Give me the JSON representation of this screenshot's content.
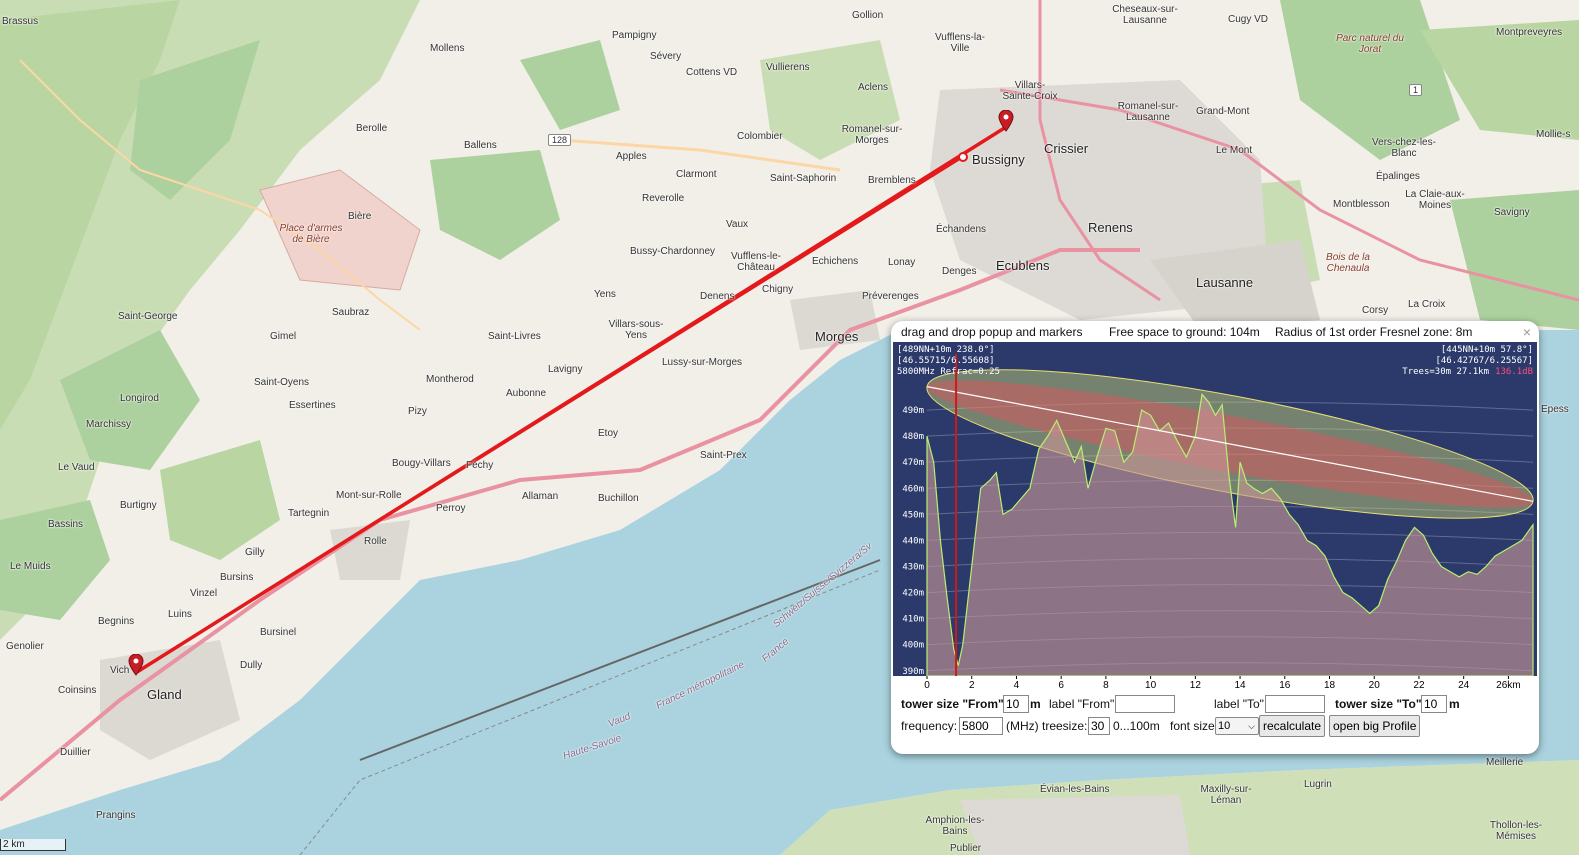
{
  "map": {
    "places": [
      {
        "id": "brassus",
        "label": "Brassus"
      },
      {
        "id": "mollens",
        "label": "Mollens"
      },
      {
        "id": "pampigny",
        "label": "Pampigny"
      },
      {
        "id": "gollion",
        "label": "Gollion"
      },
      {
        "id": "vufflens-la-ville",
        "label": "Vufflens-la-Ville"
      },
      {
        "id": "cheseaux",
        "label": "Cheseaux-sur-Lausanne"
      },
      {
        "id": "cugy",
        "label": "Cugy VD"
      },
      {
        "id": "montpreveyres",
        "label": "Montpreveyres"
      },
      {
        "id": "severy",
        "label": "Sévery"
      },
      {
        "id": "cottens",
        "label": "Cottens VD"
      },
      {
        "id": "vullierens",
        "label": "Vullierens"
      },
      {
        "id": "aclens",
        "label": "Aclens"
      },
      {
        "id": "villars-ste-croix",
        "label": "Villars-Sainte-Croix"
      },
      {
        "id": "romanel-lausanne",
        "label": "Romanel-sur-Lausanne"
      },
      {
        "id": "grand-mont",
        "label": "Grand-Mont"
      },
      {
        "id": "berolle",
        "label": "Berolle"
      },
      {
        "id": "ballens",
        "label": "Ballens"
      },
      {
        "id": "apples",
        "label": "Apples"
      },
      {
        "id": "colombier",
        "label": "Colombier"
      },
      {
        "id": "romanel-morges",
        "label": "Romanel-sur-Morges"
      },
      {
        "id": "bussigny",
        "label": "Bussigny"
      },
      {
        "id": "crissier",
        "label": "Crissier"
      },
      {
        "id": "le-mont",
        "label": "Le Mont"
      },
      {
        "id": "vers-chez-les-blanc",
        "label": "Vers-chez-les-Blanc"
      },
      {
        "id": "mollie",
        "label": "Mollie-s"
      },
      {
        "id": "clarmont",
        "label": "Clarmont"
      },
      {
        "id": "saint-saphorin",
        "label": "Saint-Saphorin"
      },
      {
        "id": "bremblens",
        "label": "Bremblens"
      },
      {
        "id": "epalinges",
        "label": "Épalinges"
      },
      {
        "id": "biere",
        "label": "Bière"
      },
      {
        "id": "reverolle",
        "label": "Reverolle"
      },
      {
        "id": "vaux",
        "label": "Vaux"
      },
      {
        "id": "echandens",
        "label": "Échandens"
      },
      {
        "id": "renens",
        "label": "Renens"
      },
      {
        "id": "montblesson",
        "label": "Montblesson"
      },
      {
        "id": "la-claie",
        "label": "La Claie-aux-Moines"
      },
      {
        "id": "savigny",
        "label": "Savigny"
      },
      {
        "id": "bussy-chardonney",
        "label": "Bussy-Chardonney"
      },
      {
        "id": "vufflens-le-chateau",
        "label": "Vufflens-le-Château"
      },
      {
        "id": "echichens",
        "label": "Echichens"
      },
      {
        "id": "lonay",
        "label": "Lonay"
      },
      {
        "id": "ecublens",
        "label": "Ecublens"
      },
      {
        "id": "denges",
        "label": "Denges"
      },
      {
        "id": "lausanne",
        "label": "Lausanne"
      },
      {
        "id": "yens",
        "label": "Yens"
      },
      {
        "id": "denens",
        "label": "Denens"
      },
      {
        "id": "chigny",
        "label": "Chigny"
      },
      {
        "id": "preverenges",
        "label": "Préverenges"
      },
      {
        "id": "la-croix",
        "label": "La Croix"
      },
      {
        "id": "corsy",
        "label": "Corsy"
      },
      {
        "id": "saint-george",
        "label": "Saint-George"
      },
      {
        "id": "saubraz",
        "label": "Saubraz"
      },
      {
        "id": "morges",
        "label": "Morges"
      },
      {
        "id": "gimel",
        "label": "Gimel"
      },
      {
        "id": "saint-livres",
        "label": "Saint-Livres"
      },
      {
        "id": "villars-sous-yens",
        "label": "Villars-sous-Yens"
      },
      {
        "id": "lussy",
        "label": "Lussy-sur-Morges"
      },
      {
        "id": "saint-oyens",
        "label": "Saint-Oyens"
      },
      {
        "id": "lavigny",
        "label": "Lavigny"
      },
      {
        "id": "longirod",
        "label": "Longirod"
      },
      {
        "id": "montherod",
        "label": "Montherod"
      },
      {
        "id": "aubonne",
        "label": "Aubonne"
      },
      {
        "id": "essertines",
        "label": "Essertines"
      },
      {
        "id": "pizy",
        "label": "Pizy"
      },
      {
        "id": "marchissy",
        "label": "Marchissy"
      },
      {
        "id": "etoy",
        "label": "Etoy"
      },
      {
        "id": "le-vaud",
        "label": "Le Vaud"
      },
      {
        "id": "bougy-villars",
        "label": "Bougy-Villars"
      },
      {
        "id": "fechy",
        "label": "Féchy"
      },
      {
        "id": "saint-prex",
        "label": "Saint-Prex"
      },
      {
        "id": "mont-sur-rolle",
        "label": "Mont-sur-Rolle"
      },
      {
        "id": "allaman",
        "label": "Allaman"
      },
      {
        "id": "buchillon",
        "label": "Buchillon"
      },
      {
        "id": "burtigny",
        "label": "Burtigny"
      },
      {
        "id": "tartegnin",
        "label": "Tartegnin"
      },
      {
        "id": "perroy",
        "label": "Perroy"
      },
      {
        "id": "bassins",
        "label": "Bassins"
      },
      {
        "id": "rolle",
        "label": "Rolle"
      },
      {
        "id": "gilly",
        "label": "Gilly"
      },
      {
        "id": "le-muids",
        "label": "Le Muids"
      },
      {
        "id": "bursins",
        "label": "Bursins"
      },
      {
        "id": "vinzel",
        "label": "Vinzel"
      },
      {
        "id": "luins",
        "label": "Luins"
      },
      {
        "id": "begnins",
        "label": "Begnins"
      },
      {
        "id": "bursinel",
        "label": "Bursinel"
      },
      {
        "id": "genolier",
        "label": "Genolier"
      },
      {
        "id": "vich",
        "label": "Vich"
      },
      {
        "id": "dully",
        "label": "Dully"
      },
      {
        "id": "coinsins",
        "label": "Coinsins"
      },
      {
        "id": "gland",
        "label": "Gland"
      },
      {
        "id": "duillier",
        "label": "Duillier"
      },
      {
        "id": "prangins",
        "label": "Prangins"
      },
      {
        "id": "meillerie",
        "label": "Meillerie"
      },
      {
        "id": "lugrin",
        "label": "Lugrin"
      },
      {
        "id": "evian",
        "label": "Évian-les-Bains"
      },
      {
        "id": "maxilly",
        "label": "Maxilly-sur-Léman"
      },
      {
        "id": "amphion",
        "label": "Amphion-les-Bains"
      },
      {
        "id": "thollon",
        "label": "Thollon-les-Mémises"
      },
      {
        "id": "publier",
        "label": "Publier"
      },
      {
        "id": "epesses",
        "label": "Epess"
      }
    ],
    "italic_labels": [
      {
        "id": "jorat",
        "label": "Parc naturel du Jorat"
      },
      {
        "id": "place-armes",
        "label": "Place d'armes de Bière"
      },
      {
        "id": "chenaula",
        "label": "Bois de la Chenaula"
      }
    ],
    "water_labels": [
      {
        "id": "vaud",
        "label": "Vaud"
      },
      {
        "id": "france-metro",
        "label": "France métropolitaine"
      },
      {
        "id": "haute-savoie",
        "label": "Haute-Savoie"
      },
      {
        "id": "france",
        "label": "France"
      },
      {
        "id": "schweiz",
        "label": "Schweiz/Suisse/Svizzera/Sv"
      }
    ],
    "road_badges": [
      {
        "id": "r128",
        "label": "128"
      },
      {
        "id": "r1",
        "label": "1"
      }
    ],
    "scale_label": "2 km",
    "colors": {
      "water": "#aad3df",
      "land": "#f2efe9",
      "forest": "#add19e",
      "link": "#e31a1c"
    }
  },
  "popup": {
    "header": {
      "drag_label": "drag and drop popup and markers",
      "free_space": "Free space to ground: 104m",
      "fresnel": "Radius of 1st order Fresnel zone: 8m",
      "close": "×"
    },
    "profile": {
      "info_left": [
        "[489NN+10m 238.0°]",
        "[46.55715/6.55608]",
        "5800MHz Refrac=0.25"
      ],
      "info_right": [
        "[445NN+10m 57.8°]",
        "[46.42767/6.25567]",
        "Trees=30m 27.1km"
      ],
      "loss": "136.1dB",
      "y_ticks": [
        "490m",
        "480m",
        "470m",
        "460m",
        "450m",
        "440m",
        "430m",
        "420m",
        "410m",
        "400m",
        "390m"
      ],
      "x_ticks": [
        "0",
        "2",
        "4",
        "6",
        "8",
        "10",
        "12",
        "14",
        "16",
        "18",
        "20",
        "22",
        "24",
        "26km"
      ]
    },
    "form": {
      "tower_from_label": "tower size \"From\"",
      "tower_from_value": "10",
      "unit_m": "m",
      "label_from": "label \"From\"",
      "label_from_value": "",
      "label_to": "label \"To\"",
      "label_to_value": "",
      "tower_to_label": "tower size \"To\"",
      "tower_to_value": "10",
      "frequency_label": "frequency:",
      "frequency_value": "5800",
      "mhz": "(MHz)",
      "treesize_label": "treesize:",
      "treesize_value": "30",
      "treesize_range": "0...100m",
      "fontsize_label": "font size",
      "fontsize_value": "10",
      "recalculate": "recalculate",
      "open_big": "open big Profile"
    }
  },
  "chart_data": {
    "type": "area",
    "title": "",
    "xlabel": "",
    "ylabel": "",
    "xlim": [
      0,
      27.1
    ],
    "ylim": [
      388,
      500
    ],
    "x_ticks": [
      0,
      2,
      4,
      6,
      8,
      10,
      12,
      14,
      16,
      18,
      20,
      22,
      24,
      26
    ],
    "y_ticks": [
      390,
      400,
      410,
      420,
      430,
      440,
      450,
      460,
      470,
      480,
      490
    ],
    "series": [
      {
        "x": [
          0,
          0.3,
          0.6,
          0.9,
          1.2,
          1.4,
          1.6,
          2.0,
          2.4,
          2.8,
          3.1,
          3.4,
          3.8,
          4.2,
          4.6,
          5.0,
          5.4,
          5.8,
          6.2,
          6.6,
          6.9,
          7.2,
          7.6,
          8.0,
          8.4,
          8.8,
          9.2,
          9.6,
          10.0,
          10.4,
          10.8,
          11.2,
          11.6,
          12.0,
          12.3,
          12.6,
          12.9,
          13.2,
          13.5,
          13.8,
          14.0,
          14.3,
          14.6,
          15.0,
          15.4,
          15.8,
          16.2,
          16.6,
          17.0,
          17.4,
          17.8,
          18.2,
          18.6,
          19.0,
          19.4,
          19.8,
          20.2,
          20.6,
          21.0,
          21.4,
          21.8,
          22.2,
          22.6,
          23.0,
          23.4,
          23.8,
          24.2,
          24.6,
          25.0,
          25.4,
          25.8,
          26.2,
          26.6,
          27.1
        ],
        "y": [
          480,
          470,
          440,
          418,
          398,
          392,
          400,
          430,
          460,
          463,
          466,
          450,
          452,
          456,
          460,
          475,
          480,
          486,
          478,
          470,
          476,
          460,
          472,
          483,
          482,
          470,
          474,
          490,
          488,
          482,
          485,
          478,
          472,
          480,
          496,
          493,
          488,
          492,
          465,
          445,
          470,
          462,
          460,
          458,
          460,
          456,
          450,
          446,
          440,
          438,
          434,
          426,
          420,
          418,
          415,
          412,
          415,
          425,
          432,
          440,
          445,
          442,
          435,
          430,
          428,
          426,
          428,
          427,
          430,
          434,
          436,
          438,
          440,
          446
        ]
      }
    ],
    "link_line": {
      "from_height": 499,
      "to_height": 455
    }
  }
}
